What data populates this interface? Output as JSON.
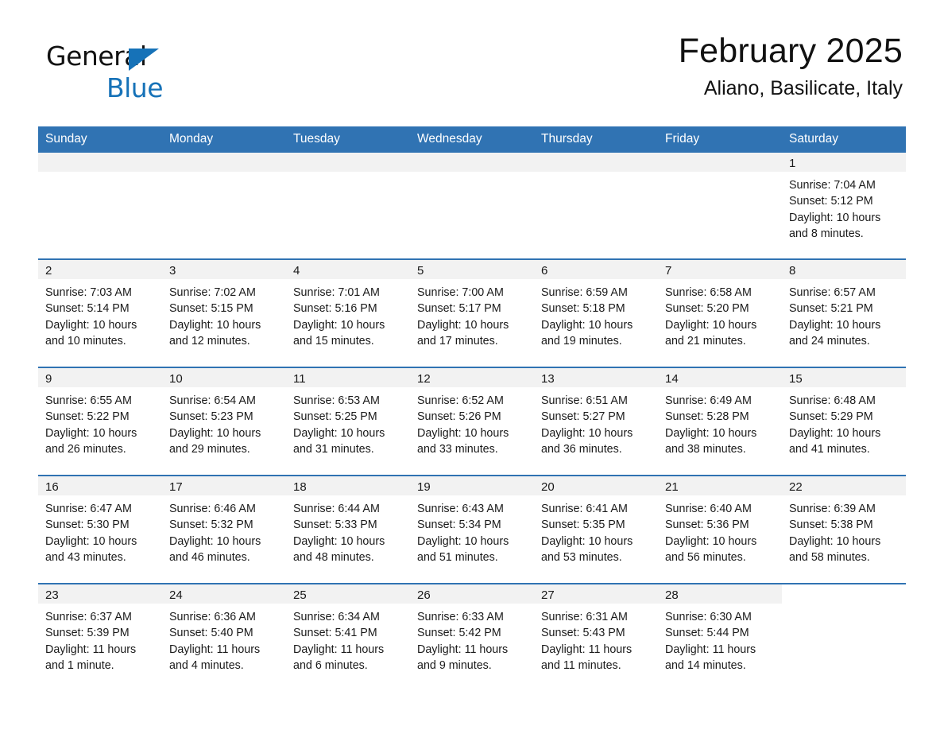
{
  "brand": {
    "word1": "General",
    "word2": "Blue",
    "triangle_icon": "blue-triangle-icon",
    "blue": "#1672b8"
  },
  "header": {
    "month_title": "February 2025",
    "location": "Aliano, Basilicate, Italy"
  },
  "theme": {
    "header_blue": "#3073b3",
    "daynum_band": "#f2f2f2",
    "text": "#1a1a1a"
  },
  "calendar": {
    "weekday_headers": [
      "Sunday",
      "Monday",
      "Tuesday",
      "Wednesday",
      "Thursday",
      "Friday",
      "Saturday"
    ],
    "labels": {
      "sunrise": "Sunrise:",
      "sunset": "Sunset:",
      "daylight": "Daylight:"
    },
    "weeks": [
      [
        {
          "day": "",
          "sunrise": "",
          "sunset": "",
          "daylight1": "",
          "daylight2": "",
          "empty": true
        },
        {
          "day": "",
          "sunrise": "",
          "sunset": "",
          "daylight1": "",
          "daylight2": "",
          "empty": true
        },
        {
          "day": "",
          "sunrise": "",
          "sunset": "",
          "daylight1": "",
          "daylight2": "",
          "empty": true
        },
        {
          "day": "",
          "sunrise": "",
          "sunset": "",
          "daylight1": "",
          "daylight2": "",
          "empty": true
        },
        {
          "day": "",
          "sunrise": "",
          "sunset": "",
          "daylight1": "",
          "daylight2": "",
          "empty": true
        },
        {
          "day": "",
          "sunrise": "",
          "sunset": "",
          "daylight1": "",
          "daylight2": "",
          "empty": true
        },
        {
          "day": "1",
          "sunrise": "Sunrise: 7:04 AM",
          "sunset": "Sunset: 5:12 PM",
          "daylight1": "Daylight: 10 hours",
          "daylight2": "and 8 minutes."
        }
      ],
      [
        {
          "day": "2",
          "sunrise": "Sunrise: 7:03 AM",
          "sunset": "Sunset: 5:14 PM",
          "daylight1": "Daylight: 10 hours",
          "daylight2": "and 10 minutes."
        },
        {
          "day": "3",
          "sunrise": "Sunrise: 7:02 AM",
          "sunset": "Sunset: 5:15 PM",
          "daylight1": "Daylight: 10 hours",
          "daylight2": "and 12 minutes."
        },
        {
          "day": "4",
          "sunrise": "Sunrise: 7:01 AM",
          "sunset": "Sunset: 5:16 PM",
          "daylight1": "Daylight: 10 hours",
          "daylight2": "and 15 minutes."
        },
        {
          "day": "5",
          "sunrise": "Sunrise: 7:00 AM",
          "sunset": "Sunset: 5:17 PM",
          "daylight1": "Daylight: 10 hours",
          "daylight2": "and 17 minutes."
        },
        {
          "day": "6",
          "sunrise": "Sunrise: 6:59 AM",
          "sunset": "Sunset: 5:18 PM",
          "daylight1": "Daylight: 10 hours",
          "daylight2": "and 19 minutes."
        },
        {
          "day": "7",
          "sunrise": "Sunrise: 6:58 AM",
          "sunset": "Sunset: 5:20 PM",
          "daylight1": "Daylight: 10 hours",
          "daylight2": "and 21 minutes."
        },
        {
          "day": "8",
          "sunrise": "Sunrise: 6:57 AM",
          "sunset": "Sunset: 5:21 PM",
          "daylight1": "Daylight: 10 hours",
          "daylight2": "and 24 minutes."
        }
      ],
      [
        {
          "day": "9",
          "sunrise": "Sunrise: 6:55 AM",
          "sunset": "Sunset: 5:22 PM",
          "daylight1": "Daylight: 10 hours",
          "daylight2": "and 26 minutes."
        },
        {
          "day": "10",
          "sunrise": "Sunrise: 6:54 AM",
          "sunset": "Sunset: 5:23 PM",
          "daylight1": "Daylight: 10 hours",
          "daylight2": "and 29 minutes."
        },
        {
          "day": "11",
          "sunrise": "Sunrise: 6:53 AM",
          "sunset": "Sunset: 5:25 PM",
          "daylight1": "Daylight: 10 hours",
          "daylight2": "and 31 minutes."
        },
        {
          "day": "12",
          "sunrise": "Sunrise: 6:52 AM",
          "sunset": "Sunset: 5:26 PM",
          "daylight1": "Daylight: 10 hours",
          "daylight2": "and 33 minutes."
        },
        {
          "day": "13",
          "sunrise": "Sunrise: 6:51 AM",
          "sunset": "Sunset: 5:27 PM",
          "daylight1": "Daylight: 10 hours",
          "daylight2": "and 36 minutes."
        },
        {
          "day": "14",
          "sunrise": "Sunrise: 6:49 AM",
          "sunset": "Sunset: 5:28 PM",
          "daylight1": "Daylight: 10 hours",
          "daylight2": "and 38 minutes."
        },
        {
          "day": "15",
          "sunrise": "Sunrise: 6:48 AM",
          "sunset": "Sunset: 5:29 PM",
          "daylight1": "Daylight: 10 hours",
          "daylight2": "and 41 minutes."
        }
      ],
      [
        {
          "day": "16",
          "sunrise": "Sunrise: 6:47 AM",
          "sunset": "Sunset: 5:30 PM",
          "daylight1": "Daylight: 10 hours",
          "daylight2": "and 43 minutes."
        },
        {
          "day": "17",
          "sunrise": "Sunrise: 6:46 AM",
          "sunset": "Sunset: 5:32 PM",
          "daylight1": "Daylight: 10 hours",
          "daylight2": "and 46 minutes."
        },
        {
          "day": "18",
          "sunrise": "Sunrise: 6:44 AM",
          "sunset": "Sunset: 5:33 PM",
          "daylight1": "Daylight: 10 hours",
          "daylight2": "and 48 minutes."
        },
        {
          "day": "19",
          "sunrise": "Sunrise: 6:43 AM",
          "sunset": "Sunset: 5:34 PM",
          "daylight1": "Daylight: 10 hours",
          "daylight2": "and 51 minutes."
        },
        {
          "day": "20",
          "sunrise": "Sunrise: 6:41 AM",
          "sunset": "Sunset: 5:35 PM",
          "daylight1": "Daylight: 10 hours",
          "daylight2": "and 53 minutes."
        },
        {
          "day": "21",
          "sunrise": "Sunrise: 6:40 AM",
          "sunset": "Sunset: 5:36 PM",
          "daylight1": "Daylight: 10 hours",
          "daylight2": "and 56 minutes."
        },
        {
          "day": "22",
          "sunrise": "Sunrise: 6:39 AM",
          "sunset": "Sunset: 5:38 PM",
          "daylight1": "Daylight: 10 hours",
          "daylight2": "and 58 minutes."
        }
      ],
      [
        {
          "day": "23",
          "sunrise": "Sunrise: 6:37 AM",
          "sunset": "Sunset: 5:39 PM",
          "daylight1": "Daylight: 11 hours",
          "daylight2": "and 1 minute."
        },
        {
          "day": "24",
          "sunrise": "Sunrise: 6:36 AM",
          "sunset": "Sunset: 5:40 PM",
          "daylight1": "Daylight: 11 hours",
          "daylight2": "and 4 minutes."
        },
        {
          "day": "25",
          "sunrise": "Sunrise: 6:34 AM",
          "sunset": "Sunset: 5:41 PM",
          "daylight1": "Daylight: 11 hours",
          "daylight2": "and 6 minutes."
        },
        {
          "day": "26",
          "sunrise": "Sunrise: 6:33 AM",
          "sunset": "Sunset: 5:42 PM",
          "daylight1": "Daylight: 11 hours",
          "daylight2": "and 9 minutes."
        },
        {
          "day": "27",
          "sunrise": "Sunrise: 6:31 AM",
          "sunset": "Sunset: 5:43 PM",
          "daylight1": "Daylight: 11 hours",
          "daylight2": "and 11 minutes."
        },
        {
          "day": "28",
          "sunrise": "Sunrise: 6:30 AM",
          "sunset": "Sunset: 5:44 PM",
          "daylight1": "Daylight: 11 hours",
          "daylight2": "and 14 minutes."
        },
        {
          "day": "",
          "sunrise": "",
          "sunset": "",
          "daylight1": "",
          "daylight2": "",
          "blank": true
        }
      ]
    ]
  }
}
